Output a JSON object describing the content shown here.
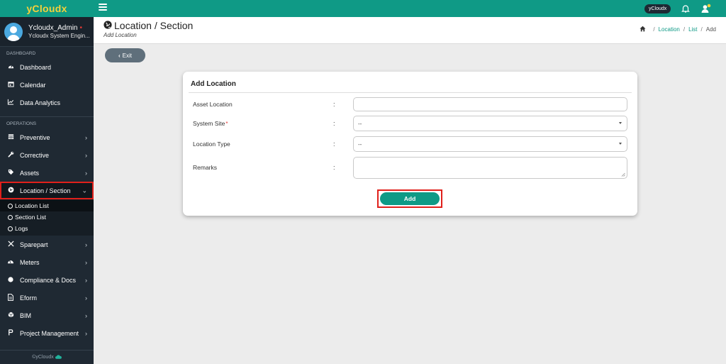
{
  "app": {
    "brand": "yCloudx",
    "footer": "©yCloudx"
  },
  "user": {
    "name": "Ycloudx_Admin",
    "role": "Ycloudx System Engin..."
  },
  "sidebar": {
    "dashboard_label": "DASHBOARD",
    "operations_label": "OPERATIONS",
    "dashboard_items": [
      {
        "label": "Dashboard",
        "icon": "tachometer-icon"
      },
      {
        "label": "Calendar",
        "icon": "calendar-icon"
      },
      {
        "label": "Data Analytics",
        "icon": "line-chart-icon"
      }
    ],
    "operations_items": [
      {
        "label": "Preventive",
        "icon": "calendar-grid-icon"
      },
      {
        "label": "Corrective",
        "icon": "wrench-icon"
      },
      {
        "label": "Assets",
        "icon": "tag-icon"
      },
      {
        "label": "Location / Section",
        "icon": "globe-icon"
      },
      {
        "label": "Sparepart",
        "icon": "wrench-screwdriver-icon"
      },
      {
        "label": "Meters",
        "icon": "gauge-icon"
      },
      {
        "label": "Compliance & Docs",
        "icon": "circle-icon"
      },
      {
        "label": "Eform",
        "icon": "file-icon"
      },
      {
        "label": "BIM",
        "icon": "cube-icon"
      },
      {
        "label": "Project Management",
        "icon": "project-icon"
      }
    ],
    "location_subitems": [
      "Location List",
      "Section List",
      "Logs"
    ]
  },
  "topbar": {
    "tenant_badge": "yCloudx"
  },
  "page": {
    "title": "Location / Section",
    "subtitle": "Add Location",
    "breadcrumb": [
      "Location",
      "List",
      "Add"
    ]
  },
  "exit_label": "Exit",
  "form": {
    "title": "Add Location",
    "colon": ":",
    "fields": [
      {
        "label": "Asset Location",
        "value": "",
        "required": false
      },
      {
        "label": "System Site",
        "value": "--",
        "required": true
      },
      {
        "label": "Location Type",
        "value": "--",
        "required": false
      },
      {
        "label": "Remarks",
        "value": "",
        "required": false
      }
    ],
    "required_mark": "*",
    "submit_label": "Add"
  },
  "colors": {
    "accent": "#0f9a86",
    "brand_text": "#f4d13b",
    "sidebar_bg": "#1f2933",
    "highlight": "#e0201b"
  }
}
